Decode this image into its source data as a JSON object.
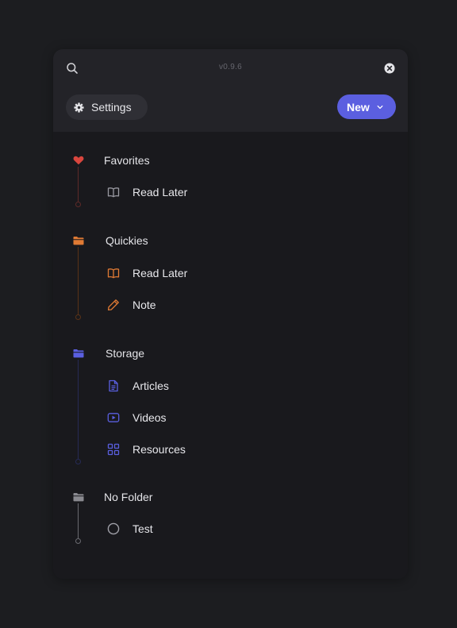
{
  "header": {
    "version": "v0.9.6",
    "search_icon": "search-icon",
    "close_icon": "close-circle-icon",
    "settings_label": "Settings",
    "settings_icon": "gear-icon",
    "new_label": "New",
    "new_icon": "chevron-down-icon"
  },
  "colors": {
    "accent": "#5b5fe0",
    "favorites": "#d9463e",
    "quickies": "#e07a34",
    "storage": "#5a5fe0",
    "no_folder": "#8a8a90"
  },
  "folders": [
    {
      "title": "Favorites",
      "icon": "heart-icon",
      "items": [
        {
          "label": "Read Later",
          "icon": "book-open-icon"
        }
      ]
    },
    {
      "title": "Quickies",
      "icon": "folder-icon",
      "items": [
        {
          "label": "Read Later",
          "icon": "book-open-icon"
        },
        {
          "label": "Note",
          "icon": "pencil-icon"
        }
      ]
    },
    {
      "title": "Storage",
      "icon": "folder-icon",
      "items": [
        {
          "label": "Articles",
          "icon": "document-icon"
        },
        {
          "label": "Videos",
          "icon": "play-icon"
        },
        {
          "label": "Resources",
          "icon": "grid-icon"
        }
      ]
    },
    {
      "title": "No Folder",
      "icon": "folder-icon",
      "items": [
        {
          "label": "Test",
          "icon": "circle-icon"
        }
      ]
    }
  ]
}
